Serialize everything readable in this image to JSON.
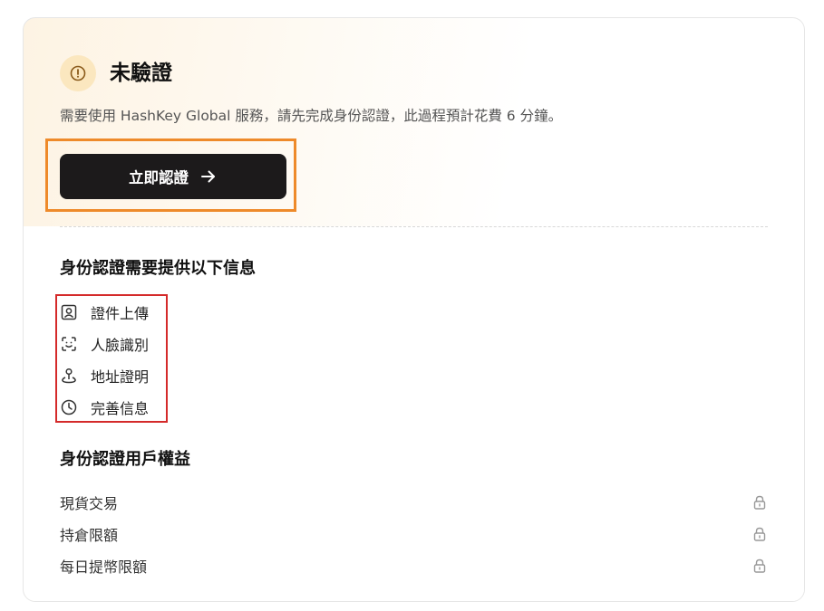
{
  "status": {
    "icon": "alert-circle-icon",
    "title": "未驗證",
    "description": "需要使用 HashKey Global 服務，請先完成身份認證，此過程預計花費 6 分鐘。"
  },
  "verify_button": {
    "label": "立即認證",
    "icon": "arrow-right-icon"
  },
  "requirements": {
    "title": "身份認證需要提供以下信息",
    "items": [
      {
        "label": "證件上傳",
        "icon": "id-card-icon"
      },
      {
        "label": "人臉識別",
        "icon": "face-scan-icon"
      },
      {
        "label": "地址證明",
        "icon": "location-pin-icon"
      },
      {
        "label": "完善信息",
        "icon": "clock-icon"
      }
    ]
  },
  "benefits": {
    "title": "身份認證用戶權益",
    "items": [
      {
        "label": "現貨交易",
        "icon": "lock-icon"
      },
      {
        "label": "持倉限額",
        "icon": "lock-icon"
      },
      {
        "label": "每日提幣限額",
        "icon": "lock-icon"
      }
    ]
  },
  "colors": {
    "accent_orange": "#ee8a2a",
    "highlight_red": "#d42a2a",
    "button_dark": "#1c1a1b",
    "status_bg": "#fbe7bf"
  }
}
